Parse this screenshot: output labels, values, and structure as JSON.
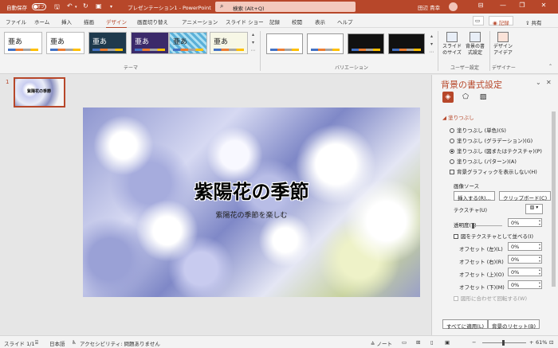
{
  "titlebar": {
    "autosave_label": "自動保存",
    "autosave_state": "オフ",
    "doc_title": "プレゼンテーション1 - PowerPoint",
    "search_placeholder": "検索 (Alt+Q)",
    "user_name": "田辺 貴幸",
    "accent_color": "#b7472a"
  },
  "menubar": {
    "tabs": [
      "ファイル",
      "ホーム",
      "挿入",
      "描画",
      "デザイン",
      "画面切り替え",
      "アニメーション",
      "スライド ショー",
      "記録",
      "校閲",
      "表示",
      "ヘルプ"
    ],
    "active_tab": "デザイン",
    "record_label": "記録",
    "share_label": "共有"
  },
  "ribbon": {
    "theme_sample": "亜あ",
    "group_theme": "テーマ",
    "group_variation": "バリエーション",
    "slide_size_label": "スライドのサイズ",
    "format_bg_label": "背景の書式設定",
    "design_ideas_label": "デザインアイデア",
    "group_user": "ユーザー設定",
    "group_designer": "デザイナー"
  },
  "thumbs": {
    "slide_number": "1",
    "thumb_title": "紫陽花の季節"
  },
  "slide": {
    "title": "紫陽花の季節",
    "subtitle": "紫陽花の季節を楽しむ"
  },
  "pane": {
    "title": "背景の書式設定",
    "section": "塗りつぶし",
    "fill_options": [
      "塗りつぶし (単色)(S)",
      "塗りつぶし (グラデーション)(G)",
      "塗りつぶし (図またはテクスチャ)(P)",
      "塗りつぶし (パターン)(A)"
    ],
    "selected_fill": "塗りつぶし (図またはテクスチャ)(P)",
    "hide_bg_graphics": "背景グラフィックを表示しない(H)",
    "image_source_label": "画像ソース",
    "insert_button": "挿入する(R)...",
    "clipboard_button": "クリップボード(C)",
    "texture_label": "テクスチャ(U)",
    "transparency_label": "透明度(T)",
    "transparency_value": "0%",
    "tile_label": "図をテクスチャとして並べる(I)",
    "offsets": [
      {
        "label": "オフセット (左)(L)",
        "value": "0%"
      },
      {
        "label": "オフセット (右)(R)",
        "value": "0%"
      },
      {
        "label": "オフセット (上)(O)",
        "value": "0%"
      },
      {
        "label": "オフセット (下)(M)",
        "value": "0%"
      }
    ],
    "rotate_label": "図形に合わせて回転する(W)",
    "apply_all_button": "すべてに適用(L)",
    "reset_button": "背景のリセット(B)"
  },
  "statusbar": {
    "slide_info": "スライド 1/1",
    "language": "日本語",
    "accessibility": "アクセシビリティ: 問題ありません",
    "notes_label": "ノート",
    "zoom": "61%"
  }
}
